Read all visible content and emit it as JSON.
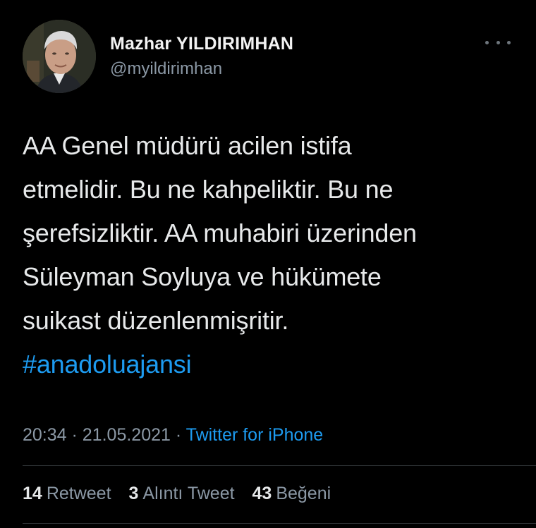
{
  "user": {
    "display_name": "Mazhar YILDIRIMHAN",
    "handle": "@myildirimhan",
    "avatar_icon": "profile-photo"
  },
  "tweet": {
    "lines": [
      "AA Genel müdürü acilen istifa",
      "etmelidir. Bu ne kahpeliktir. Bu ne",
      "şerefsizliktir. AA muhabiri üzerinden",
      "Süleyman Soyluya ve hükümete",
      "suikast düzenlenmişritir."
    ],
    "hashtag": "#anadoluajansi"
  },
  "meta": {
    "time": "20:34",
    "separator1": " · ",
    "date": "21.05.2021",
    "separator2": " · ",
    "source": "Twitter for iPhone"
  },
  "stats": {
    "retweets_count": "14",
    "retweets_label": "Retweet",
    "quotes_count": "3",
    "quotes_label": "Alıntı Tweet",
    "likes_count": "43",
    "likes_label": "Beğeni"
  },
  "colors": {
    "background": "#000000",
    "text": "#e7e9ea",
    "secondary": "#8b98a5",
    "link": "#1d9bf0"
  }
}
